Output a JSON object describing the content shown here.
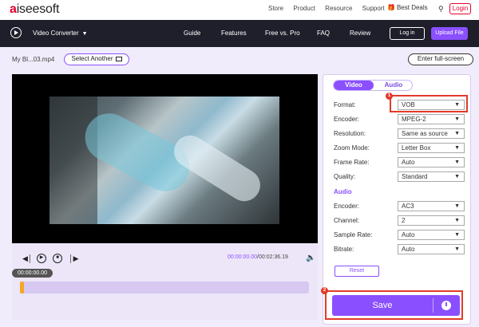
{
  "brand": {
    "logo_accent": "a",
    "logo_rest": "iseesoft",
    "accent_color": "#e6002d",
    "purple": "#8a4fff"
  },
  "top_links": [
    "Store",
    "Product",
    "Resource",
    "Support"
  ],
  "best_deals": "Best Deals",
  "top_login": "Login",
  "nav": {
    "product": "Video Converter",
    "links": [
      "Guide",
      "Features",
      "Free vs. Pro",
      "FAQ",
      "Review"
    ],
    "login": "Log in",
    "upload": "Upload File"
  },
  "file": {
    "name": "My Bl...03.mp4",
    "select_another": "Select Another",
    "fullscreen": "Enter full-screen"
  },
  "player": {
    "current_time": "00:00:00.00",
    "total_time": "00:02:36.19",
    "bubble_time": "00:00:00.00",
    "progress": 0.0
  },
  "settings": {
    "tabs": [
      "Video",
      "Audio"
    ],
    "video": [
      {
        "label": "Format:",
        "value": "VOB"
      },
      {
        "label": "Encoder:",
        "value": "MPEG-2"
      },
      {
        "label": "Resolution:",
        "value": "Same as source"
      },
      {
        "label": "Zoom Mode:",
        "value": "Letter Box"
      },
      {
        "label": "Frame Rate:",
        "value": "Auto"
      },
      {
        "label": "Quality:",
        "value": "Standard"
      }
    ],
    "audio_title": "Audio",
    "audio": [
      {
        "label": "Encoder:",
        "value": "AC3"
      },
      {
        "label": "Channel:",
        "value": "2"
      },
      {
        "label": "Sample Rate:",
        "value": "Auto"
      },
      {
        "label": "Bitrate:",
        "value": "Auto"
      }
    ],
    "reset": "Reset"
  },
  "save": "Save",
  "badges": [
    "1",
    "2"
  ]
}
